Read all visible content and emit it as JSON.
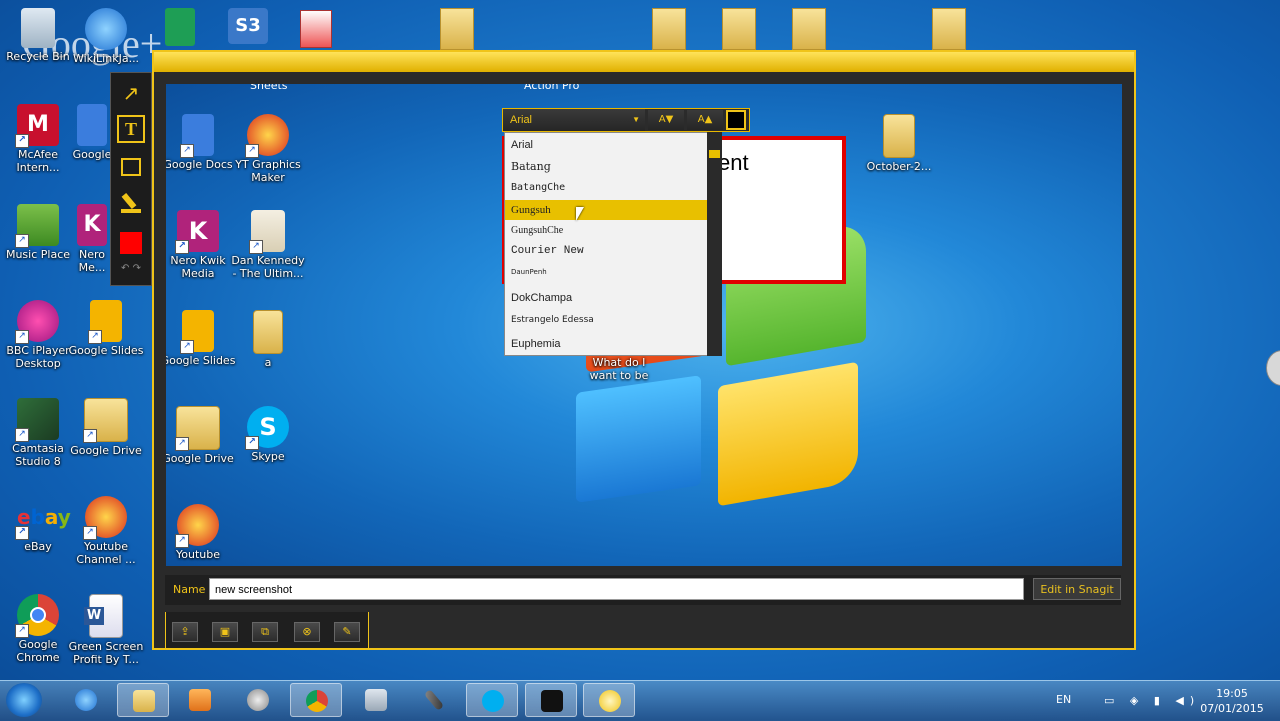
{
  "overlay": {
    "brand": "Google+"
  },
  "desktop_left": [
    {
      "label": "Recycle Bin",
      "icon": "recycle-bin-icon"
    },
    {
      "label": "WikiLinkJa...",
      "icon": "ie-icon"
    },
    {
      "label": "McAfee\nIntern...",
      "icon": "mcafee-icon"
    },
    {
      "label": "Google",
      "icon": "google-docs-icon"
    },
    {
      "label": "Music Place",
      "icon": "music-place-icon"
    },
    {
      "label": "Nero\nMe...",
      "icon": "nero-icon"
    },
    {
      "label": "BBC iPlayer\nDesktop",
      "icon": "bbc-iplayer-icon"
    },
    {
      "label": "Google Slides",
      "icon": "google-slides-icon"
    },
    {
      "label": "Camtasia\nStudio 8",
      "icon": "camtasia-icon"
    },
    {
      "label": "Google Drive",
      "icon": "google-drive-icon"
    },
    {
      "label": "eBay",
      "icon": "ebay-icon"
    },
    {
      "label": "Youtube\nChannel ...",
      "icon": "parrot-icon"
    },
    {
      "label": "Google\nChrome",
      "icon": "chrome-icon"
    },
    {
      "label": "Green Screen\nProfit By T...",
      "icon": "word-icon"
    }
  ],
  "canvas_icons": [
    {
      "label": "Sheets",
      "icon": "sheets-icon"
    },
    {
      "label": "Action Pro",
      "icon": "action-pro-icon"
    },
    {
      "label": "Google Docs",
      "icon": "google-docs-icon"
    },
    {
      "label": "YT Graphics\nMaker",
      "icon": "parrot-icon"
    },
    {
      "label": "Nero Kwik\nMedia",
      "icon": "nero-icon"
    },
    {
      "label": "Dan Kennedy\n- The Ultim...",
      "icon": "pdf-icon"
    },
    {
      "label": "Google Slides",
      "icon": "google-slides-icon"
    },
    {
      "label": "a",
      "icon": "folder-icon"
    },
    {
      "label": "Google Drive",
      "icon": "google-drive-icon"
    },
    {
      "label": "Skype",
      "icon": "skype-icon"
    },
    {
      "label": "Youtube",
      "icon": "parrot-icon"
    },
    {
      "label": "October-2...",
      "icon": "folder-icon"
    },
    {
      "label": "What do I\nwant to be",
      "icon": "folder-icon"
    }
  ],
  "callout": {
    "text": "ent"
  },
  "font_picker": {
    "current": "Arial",
    "size_down": "A▼",
    "size_up": "A▲",
    "options": [
      "Arial",
      "Batang",
      "BatangChe",
      "Gungsuh",
      "GungsuhChe",
      "Courier New",
      "DaunPenh",
      "DokChampa",
      "Estrangelo Edessa",
      "Euphemia"
    ],
    "selected_index": 3
  },
  "name_bar": {
    "label": "Name",
    "value": "new screenshot",
    "edit_button": "Edit in Snagit"
  },
  "taskbar": {
    "language": "EN",
    "time": "19:05",
    "date": "07/01/2015",
    "apps": [
      "start-orb-icon",
      "ie-icon",
      "explorer-icon",
      "media-player-icon",
      "circle-app-icon",
      "chrome-icon",
      "calculator-icon",
      "microphone-icon",
      "skype-icon",
      "blackberry-icon",
      "snagit-icon"
    ]
  },
  "colors": {
    "accent": "#f0c419",
    "selected_color": "#ff0000"
  }
}
